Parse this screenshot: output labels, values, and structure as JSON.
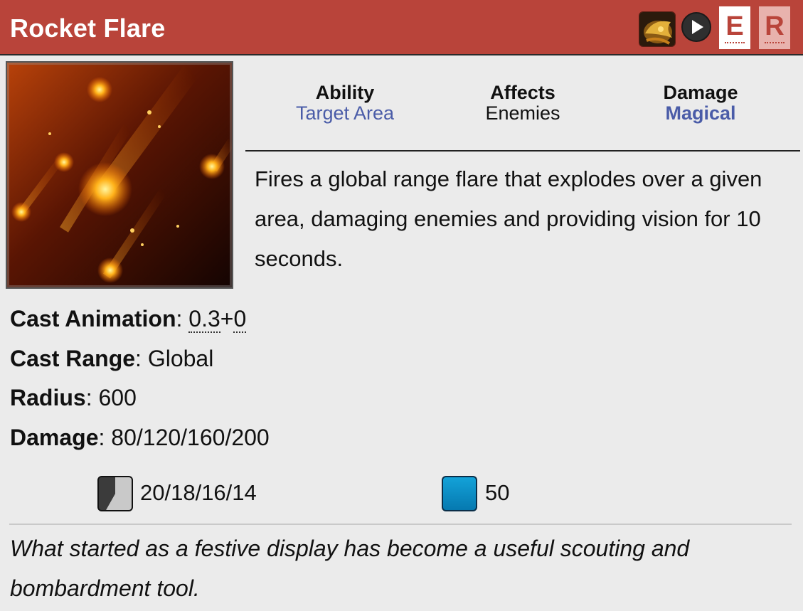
{
  "ability": {
    "title": "Rocket Flare",
    "hotkeys": [
      "E",
      "R"
    ],
    "stats": [
      {
        "label": "Ability",
        "value": "Target Area"
      },
      {
        "label": "Affects",
        "value": "Enemies"
      },
      {
        "label": "Damage",
        "value": "Magical"
      }
    ],
    "description": "Fires a global range flare that explodes over a given area, damaging enemies and providing vision for 10 seconds.",
    "cast_animation_label": "Cast Animation",
    "cast_animation_a": "0.3",
    "cast_animation_sep": "+",
    "cast_animation_b": "0",
    "attributes": [
      {
        "label": "Cast Range",
        "value": "Global"
      },
      {
        "label": "Radius",
        "value": "600"
      },
      {
        "label": "Damage",
        "value": "80/120/160/200"
      }
    ],
    "cooldown": "20/18/16/14",
    "mana": "50",
    "lore": "What started as a festive display has become a useful scouting and bombardment tool."
  },
  "icons": {
    "hero": "hero-portrait-icon",
    "play": "play-icon",
    "cooldown": "cooldown-icon",
    "mana": "mana-icon"
  },
  "colors": {
    "header": "#b9443a",
    "link": "#4a5ca8",
    "background": "#ebebeb",
    "mana": "#13a2d8"
  }
}
